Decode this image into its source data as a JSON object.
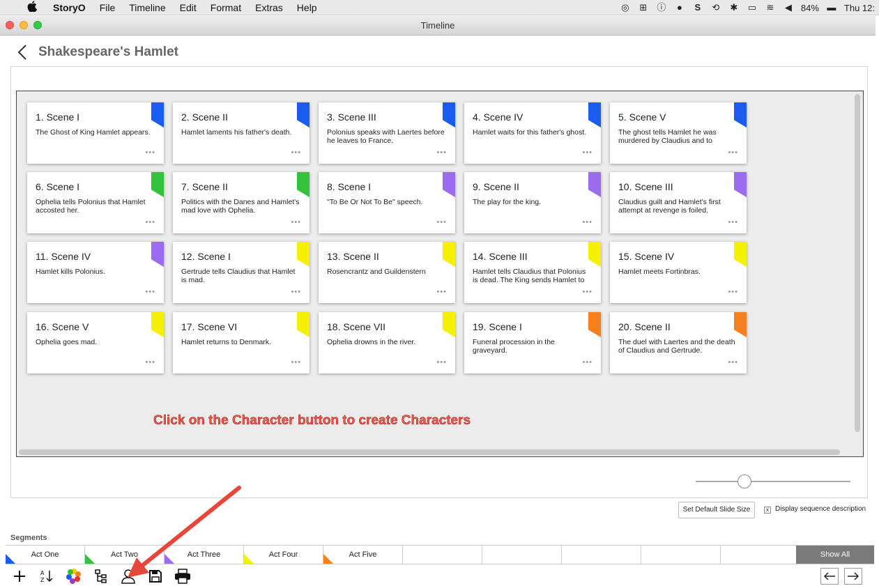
{
  "menubar": {
    "app": "StoryO",
    "items": [
      "File",
      "Timeline",
      "Edit",
      "Format",
      "Extras",
      "Help"
    ],
    "battery": "84%",
    "clock": "Thu 12:"
  },
  "window": {
    "title": "Timeline"
  },
  "page": {
    "title": "Shakespeare's Hamlet"
  },
  "colors": {
    "blue": "#1a5cf0",
    "green": "#33c23a",
    "purple": "#9b6cf0",
    "yellow": "#f5f000",
    "orange": "#f7801e"
  },
  "cards": [
    {
      "title": "1. Scene I",
      "desc": "The Ghost of King Hamlet appears.",
      "color": "#1a5cf0"
    },
    {
      "title": "2. Scene II",
      "desc": "Hamlet laments his father's death.",
      "color": "#1a5cf0"
    },
    {
      "title": "3. Scene III",
      "desc": "Polonius speaks with Laertes before he leaves to France.",
      "color": "#1a5cf0"
    },
    {
      "title": "4. Scene IV",
      "desc": "Hamlet waits for this father's ghost.",
      "color": "#1a5cf0"
    },
    {
      "title": "5. Scene V",
      "desc": "The ghost tells Hamlet he was murdered by Claudius and to",
      "color": "#1a5cf0"
    },
    {
      "title": "6. Scene I",
      "desc": "Ophelia tells Polonius that Hamlet accosted her.",
      "color": "#33c23a"
    },
    {
      "title": "7. Scene II",
      "desc": "Politics with the Danes and Hamlet's mad love with Ophelia.",
      "color": "#33c23a"
    },
    {
      "title": "8. Scene I",
      "desc": "\"To Be Or Not To Be\" speech.",
      "color": "#9b6cf0"
    },
    {
      "title": "9. Scene II",
      "desc": "The play for the king.",
      "color": "#9b6cf0"
    },
    {
      "title": "10. Scene III",
      "desc": "Claudius guilt and Hamlet's first attempt at revenge is foiled.",
      "color": "#9b6cf0"
    },
    {
      "title": "11. Scene IV",
      "desc": "Hamlet kills Polonius.",
      "color": "#9b6cf0"
    },
    {
      "title": "12. Scene I",
      "desc": "Gertrude tells Claudius that Hamlet is mad.",
      "color": "#f5f000"
    },
    {
      "title": "13. Scene II",
      "desc": "Rosencrantz and Guildenstern",
      "color": "#f5f000"
    },
    {
      "title": "14. Scene III",
      "desc": "Hamlet tells Claudius that Polonius is dead. The King sends Hamlet to",
      "color": "#f5f000"
    },
    {
      "title": "15. Scene IV",
      "desc": "Hamlet meets Fortinbras.",
      "color": "#f5f000"
    },
    {
      "title": "16. Scene V",
      "desc": "Ophelia goes mad.",
      "color": "#f5f000"
    },
    {
      "title": "17. Scene VI",
      "desc": "Hamlet returns to Denmark.",
      "color": "#f5f000"
    },
    {
      "title": "18. Scene VII",
      "desc": "Ophelia drowns in the river.",
      "color": "#f5f000"
    },
    {
      "title": "19. Scene I",
      "desc": "Funeral procession in the graveyard.",
      "color": "#f7801e"
    },
    {
      "title": "20. Scene II",
      "desc": "The duel with Laertes and the death of Claudius and Gertrude.",
      "color": "#f7801e"
    }
  ],
  "card_more": "•••",
  "annotation": "Click on the Character button to create Characters",
  "controls": {
    "default_size_label": "Set Default Slide Size",
    "display_seq_label": "Display sequence description",
    "display_seq_checked": "x"
  },
  "segments": {
    "label": "Segments",
    "items": [
      {
        "label": "Act One",
        "color": "#1a5cf0"
      },
      {
        "label": "Act Two",
        "color": "#33c23a"
      },
      {
        "label": "Act Three",
        "color": "#9b6cf0"
      },
      {
        "label": "Act Four",
        "color": "#f5f000"
      },
      {
        "label": "Act Five",
        "color": "#f7801e"
      },
      {
        "label": "",
        "color": ""
      },
      {
        "label": "",
        "color": ""
      },
      {
        "label": "",
        "color": ""
      },
      {
        "label": "",
        "color": ""
      },
      {
        "label": "",
        "color": ""
      }
    ],
    "show_all": "Show All"
  },
  "toolbar": {
    "icons": [
      "plus-icon",
      "sort-az-icon",
      "color-wheel-icon",
      "hierarchy-icon",
      "character-icon",
      "save-icon",
      "print-icon"
    ]
  }
}
